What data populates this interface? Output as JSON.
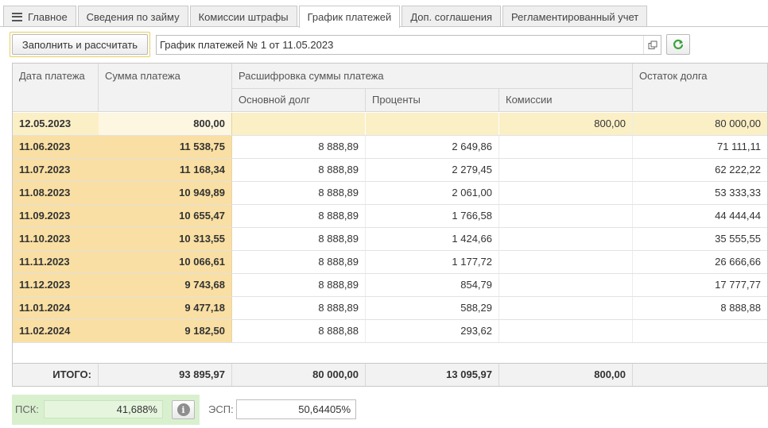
{
  "tabs": [
    {
      "label": "Главное"
    },
    {
      "label": "Сведения по займу"
    },
    {
      "label": "Комиссии штрафы"
    },
    {
      "label": "График платежей"
    },
    {
      "label": "Доп. соглашения"
    },
    {
      "label": "Регламентированный учет"
    }
  ],
  "toolbar": {
    "fill_button": "Заполнить и рассчитать",
    "schedule_value": "График платежей № 1 от 11.05.2023"
  },
  "table": {
    "headers": {
      "date": "Дата платежа",
      "sum": "Сумма платежа",
      "breakdown": "Расшифровка суммы платежа",
      "principal": "Основной долг",
      "interest": "Проценты",
      "commission": "Комиссии",
      "balance": "Остаток долга"
    },
    "rows": [
      {
        "date": "12.05.2023",
        "sum": "800,00",
        "principal": "",
        "interest": "",
        "commission": "800,00",
        "balance": "80 000,00"
      },
      {
        "date": "11.06.2023",
        "sum": "11 538,75",
        "principal": "8 888,89",
        "interest": "2 649,86",
        "commission": "",
        "balance": "71 111,11"
      },
      {
        "date": "11.07.2023",
        "sum": "11 168,34",
        "principal": "8 888,89",
        "interest": "2 279,45",
        "commission": "",
        "balance": "62 222,22"
      },
      {
        "date": "11.08.2023",
        "sum": "10 949,89",
        "principal": "8 888,89",
        "interest": "2 061,00",
        "commission": "",
        "balance": "53 333,33"
      },
      {
        "date": "11.09.2023",
        "sum": "10 655,47",
        "principal": "8 888,89",
        "interest": "1 766,58",
        "commission": "",
        "balance": "44 444,44"
      },
      {
        "date": "11.10.2023",
        "sum": "10 313,55",
        "principal": "8 888,89",
        "interest": "1 424,66",
        "commission": "",
        "balance": "35 555,55"
      },
      {
        "date": "11.11.2023",
        "sum": "10 066,61",
        "principal": "8 888,89",
        "interest": "1 177,72",
        "commission": "",
        "balance": "26 666,66"
      },
      {
        "date": "11.12.2023",
        "sum": "9 743,68",
        "principal": "8 888,89",
        "interest": "854,79",
        "commission": "",
        "balance": "17 777,77"
      },
      {
        "date": "11.01.2024",
        "sum": "9 477,18",
        "principal": "8 888,89",
        "interest": "588,29",
        "commission": "",
        "balance": "8 888,88"
      },
      {
        "date": "11.02.2024",
        "sum": "9 182,50",
        "principal": "8 888,88",
        "interest": "293,62",
        "commission": "",
        "balance": ""
      }
    ],
    "totals": {
      "label": "ИТОГО:",
      "sum": "93 895,97",
      "principal": "80 000,00",
      "interest": "13 095,97",
      "commission": "800,00"
    }
  },
  "bottom": {
    "psk_label": "ПСК:",
    "psk_value": "41,688%",
    "esp_label": "ЭСП:",
    "esp_value": "50,64405%"
  },
  "colors": {
    "highlight_column": "#f9dfa3",
    "first_row": "#fbefc6",
    "psk_background": "#d9f0cf",
    "refresh_green": "#3aa33a"
  }
}
